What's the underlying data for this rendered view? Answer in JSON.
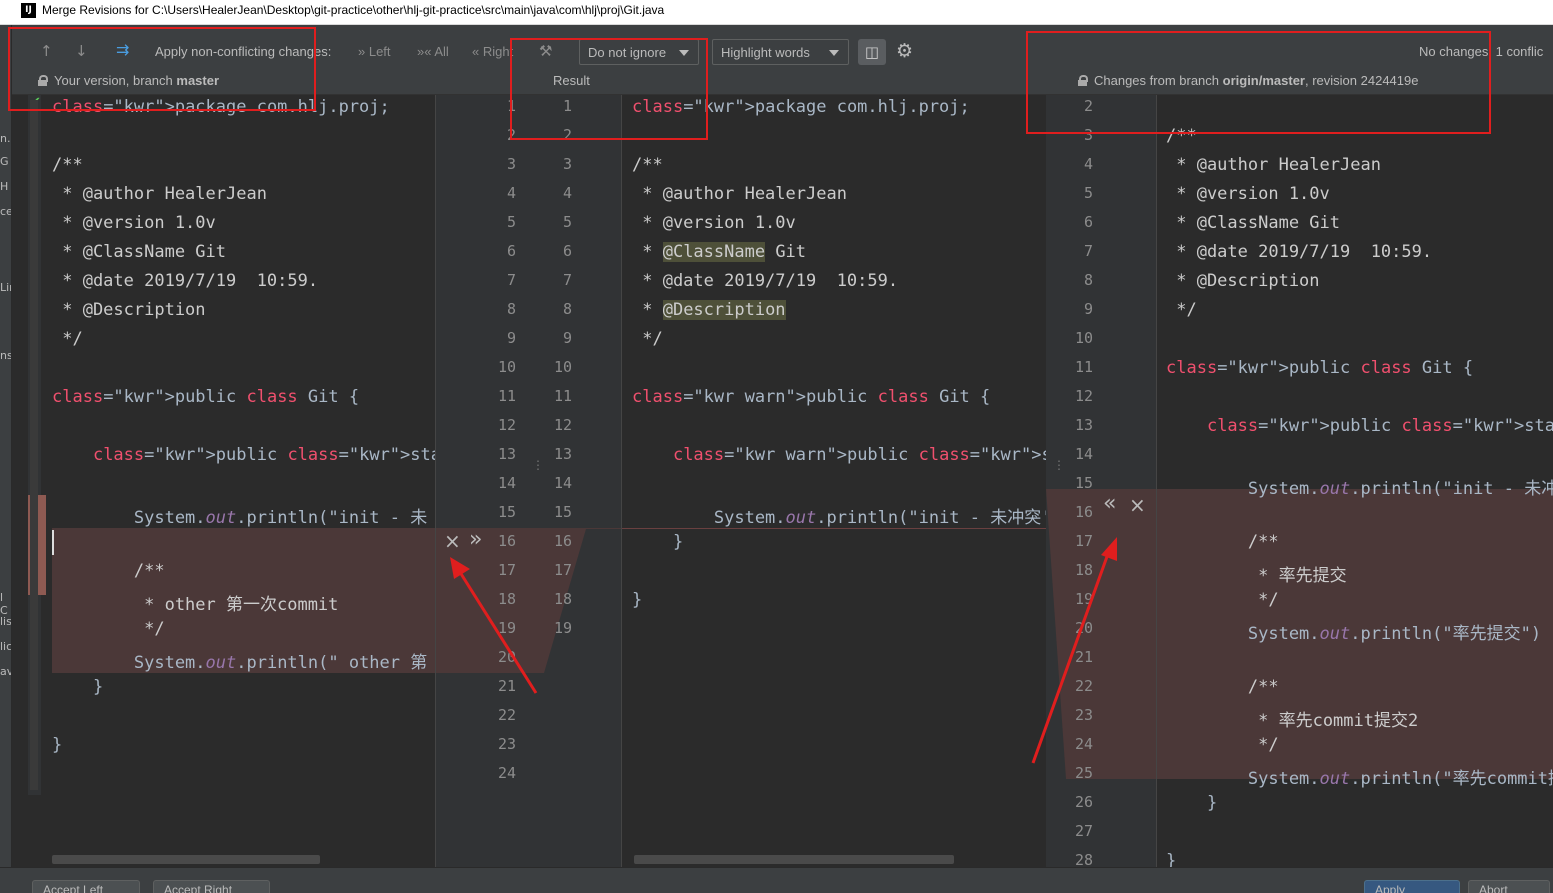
{
  "window": {
    "title": "Merge Revisions for C:\\Users\\HealerJean\\Desktop\\git-practice\\other\\hlj-git-practice\\src\\main\\java\\com\\hlj\\proj\\Git.java",
    "app_icon": "IJ"
  },
  "left_strip": [
    "n.l",
    "G",
    "H",
    "ce",
    "Lin",
    "ns",
    "l C",
    "lis",
    "lic",
    "av"
  ],
  "toolbar": {
    "prev_icon": "arrow-up-icon",
    "next_icon": "arrow-down-icon",
    "apply_icon": "merge-arrows-icon",
    "apply_label": "Apply non-conflicting changes:",
    "left_label": "Left",
    "all_label": "All",
    "right_label": "Right",
    "ignore_select": "Do not ignore",
    "highlight_select": "Highlight words",
    "status": "No changes. 1 conflic",
    "left_header": "Your version, branch",
    "left_branch": "master",
    "center_header": "Result",
    "right_header_pre": "Changes from branch",
    "right_branch": "origin/master",
    "right_header_post": ", revision 2424419e"
  },
  "left_pane": {
    "lines": [
      {
        "n": 1,
        "t": "package com.hlj.proj;"
      },
      {
        "n": 3,
        "t": "/**"
      },
      {
        "n": 4,
        "t": " * @author HealerJean"
      },
      {
        "n": 5,
        "t": " * @version 1.0v"
      },
      {
        "n": 6,
        "t": " * @ClassName Git"
      },
      {
        "n": 7,
        "t": " * @date 2019/7/19  10:59."
      },
      {
        "n": 8,
        "t": " * @Description"
      },
      {
        "n": 9,
        "t": " */"
      },
      {
        "n": 11,
        "t": "public class Git {"
      },
      {
        "n": 13,
        "t": "    public static void main(String[] a"
      },
      {
        "n": 15,
        "t": "        System.out.println(\"init - 未"
      },
      {
        "n": 17,
        "t": "        /**"
      },
      {
        "n": 18,
        "t": "         * other 第一次commit"
      },
      {
        "n": 19,
        "t": "         */"
      },
      {
        "n": 20,
        "t": "        System.out.println(\" other 第"
      },
      {
        "n": 21,
        "t": "    }"
      },
      {
        "n": 23,
        "t": "}"
      }
    ],
    "line_numbers": [
      1,
      2,
      3,
      4,
      5,
      6,
      7,
      8,
      9,
      10,
      11,
      12,
      13,
      14,
      15,
      16,
      17,
      18,
      19,
      20,
      21,
      22,
      23,
      24
    ]
  },
  "center_pane": {
    "line_numbers": [
      1,
      2,
      3,
      4,
      5,
      6,
      7,
      8,
      9,
      10,
      11,
      12,
      13,
      14,
      15,
      16,
      17,
      18,
      19
    ],
    "lines": [
      {
        "n": 1,
        "t": "package com.hlj.proj;"
      },
      {
        "n": 3,
        "t": "/**"
      },
      {
        "n": 4,
        "t": " * @author HealerJean"
      },
      {
        "n": 5,
        "t": " * @version 1.0v"
      },
      {
        "n": 6,
        "t": " * @ClassName Git"
      },
      {
        "n": 7,
        "t": " * @date 2019/7/19  10:59."
      },
      {
        "n": 8,
        "t": " * @Description"
      },
      {
        "n": 9,
        "t": " */"
      },
      {
        "n": 11,
        "t": "public class Git {"
      },
      {
        "n": 13,
        "t": "    public static void main(String[] args"
      },
      {
        "n": 15,
        "t": "        System.out.println(\"init - 未冲突'"
      },
      {
        "n": 16,
        "t": "    }"
      },
      {
        "n": 18,
        "t": "}"
      }
    ]
  },
  "right_pane": {
    "line_numbers": [
      2,
      3,
      4,
      5,
      6,
      7,
      8,
      9,
      10,
      11,
      12,
      13,
      14,
      15,
      16,
      17,
      18,
      19,
      20,
      21,
      22,
      23,
      24,
      25,
      26,
      27,
      28
    ],
    "lines": [
      {
        "n": 3,
        "t": "/**"
      },
      {
        "n": 4,
        "t": " * @author HealerJean"
      },
      {
        "n": 5,
        "t": " * @version 1.0v"
      },
      {
        "n": 6,
        "t": " * @ClassName Git"
      },
      {
        "n": 7,
        "t": " * @date 2019/7/19  10:59."
      },
      {
        "n": 8,
        "t": " * @Description"
      },
      {
        "n": 9,
        "t": " */"
      },
      {
        "n": 11,
        "t": "public class Git {"
      },
      {
        "n": 13,
        "t": "    public static void main(String[] ar"
      },
      {
        "n": 15,
        "t": "        System.out.println(\"init - 未冲"
      },
      {
        "n": 17,
        "t": "        /**"
      },
      {
        "n": 18,
        "t": "         * 率先提交"
      },
      {
        "n": 19,
        "t": "         */"
      },
      {
        "n": 20,
        "t": "        System.out.println(\"率先提交\")"
      },
      {
        "n": 22,
        "t": "        /**"
      },
      {
        "n": 23,
        "t": "         * 率先commit提交2"
      },
      {
        "n": 24,
        "t": "         */"
      },
      {
        "n": 25,
        "t": "        System.out.println(\"率先commit提"
      },
      {
        "n": 26,
        "t": "    }"
      },
      {
        "n": 28,
        "t": "}"
      }
    ]
  },
  "actions": {
    "left_reject": "×",
    "left_accept": "»",
    "right_accept": "«",
    "right_reject": "×"
  },
  "bottom": {
    "accept_left": "Accept Left",
    "accept_right": "Accept Right",
    "apply": "Apply",
    "abort": "Abort"
  },
  "colors": {
    "keyword": "#cc7832",
    "keyword_red": "#f0506e",
    "conflict_bg": "#4b3838",
    "annotation_box": "#e01e1e"
  }
}
